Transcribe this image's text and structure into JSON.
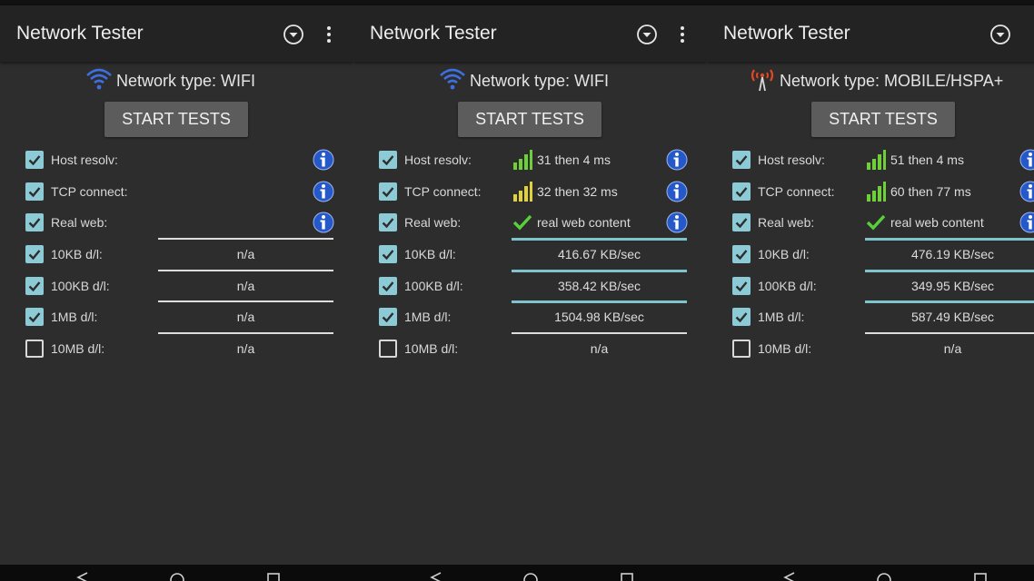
{
  "colors": {
    "panel_bg": "#2d2d2d",
    "appbar_bg": "#232323",
    "checkbox_on": "#8ccbd6",
    "divider_light": "#dddddd",
    "divider_teal": "#7fc4cc",
    "info_icon_blue": "#2558c9",
    "bars_green": "#6fcf3a",
    "bars_yellow": "#e0d23a",
    "check_green": "#57d13a",
    "wifi_blue": "#3d6fe0",
    "mobile_red": "#e04822"
  },
  "panels": [
    {
      "app_title": "Network Tester",
      "network_type": "Network type: WIFI",
      "network_icon": "wifi-icon",
      "start_button": "START TESTS",
      "tests": [
        {
          "label": "Host resolv:",
          "checked": true,
          "result": ""
        },
        {
          "label": "TCP connect:",
          "checked": true,
          "result": ""
        },
        {
          "label": "Real web:",
          "checked": true,
          "result": ""
        }
      ],
      "downloads": [
        {
          "label": "10KB d/l:",
          "checked": true,
          "value": "n/a"
        },
        {
          "label": "100KB d/l:",
          "checked": true,
          "value": "n/a"
        },
        {
          "label": "1MB d/l:",
          "checked": true,
          "value": "n/a"
        },
        {
          "label": "10MB d/l:",
          "checked": false,
          "value": "n/a"
        }
      ]
    },
    {
      "app_title": "Network Tester",
      "network_type": "Network type: WIFI",
      "network_icon": "wifi-icon",
      "start_button": "START TESTS",
      "tests": [
        {
          "label": "Host resolv:",
          "checked": true,
          "result": "31 then 4 ms",
          "result_icon": "signal-bars-green-icon"
        },
        {
          "label": "TCP connect:",
          "checked": true,
          "result": "32 then 32 ms",
          "result_icon": "signal-bars-yellow-icon"
        },
        {
          "label": "Real web:",
          "checked": true,
          "result": "real web content",
          "result_icon": "green-check-icon"
        }
      ],
      "downloads": [
        {
          "label": "10KB d/l:",
          "checked": true,
          "value": "416.67 KB/sec"
        },
        {
          "label": "100KB d/l:",
          "checked": true,
          "value": "358.42 KB/sec"
        },
        {
          "label": "1MB d/l:",
          "checked": true,
          "value": "1504.98 KB/sec"
        },
        {
          "label": "10MB d/l:",
          "checked": false,
          "value": "n/a"
        }
      ]
    },
    {
      "app_title": "Network Tester",
      "network_type": "Network type: MOBILE/HSPA+",
      "network_icon": "mobile-signal-icon",
      "start_button": "START TESTS",
      "tests": [
        {
          "label": "Host resolv:",
          "checked": true,
          "result": "51 then 4 ms",
          "result_icon": "signal-bars-green-icon"
        },
        {
          "label": "TCP connect:",
          "checked": true,
          "result": "60 then 77 ms",
          "result_icon": "signal-bars-green-icon"
        },
        {
          "label": "Real web:",
          "checked": true,
          "result": "real web content",
          "result_icon": "green-check-icon"
        }
      ],
      "downloads": [
        {
          "label": "10KB d/l:",
          "checked": true,
          "value": "476.19 KB/sec"
        },
        {
          "label": "100KB d/l:",
          "checked": true,
          "value": "349.95 KB/sec"
        },
        {
          "label": "1MB d/l:",
          "checked": true,
          "value": "587.49 KB/sec"
        },
        {
          "label": "10MB d/l:",
          "checked": false,
          "value": "n/a"
        }
      ]
    }
  ]
}
